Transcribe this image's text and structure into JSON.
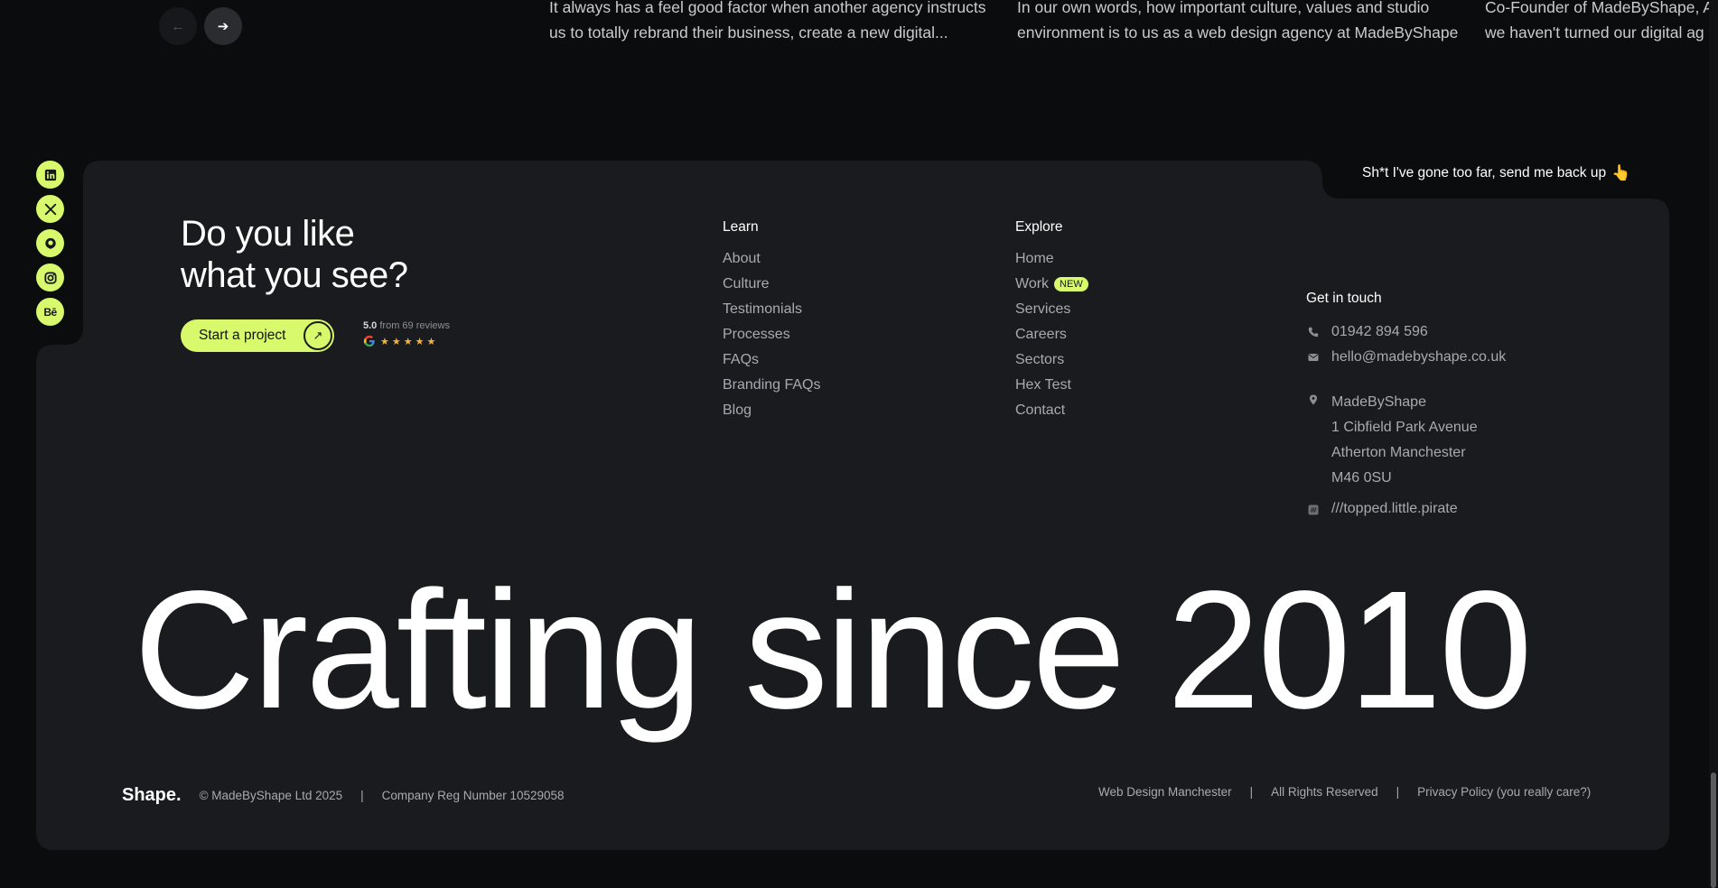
{
  "carousel": {
    "prev_icon": "arrow-left-icon",
    "next_icon": "arrow-right-icon",
    "quotes": [
      {
        "line1": "It always has a feel good factor when another agency instructs",
        "line2": "us to totally rebrand their business, create a new digital..."
      },
      {
        "line1": "In our own words, how important culture, values and studio",
        "line2": "environment is to us as a web design agency at MadeByShape"
      },
      {
        "line1": "Co-Founder of MadeByShape, A",
        "line2": "we haven't turned our digital ag"
      }
    ]
  },
  "social": [
    "linkedin-icon",
    "x-icon",
    "github-icon",
    "instagram-icon",
    "behance-icon"
  ],
  "behance_label": "Bē",
  "back_up": {
    "label": "Sh*t I've gone too far, send me back up",
    "emoji": "👆"
  },
  "headline": {
    "line1": "Do you like",
    "line2": "what you see?"
  },
  "cta": {
    "label": "Start a project",
    "arrow": "↗"
  },
  "rating": {
    "score": "5.0",
    "text": " from 69 reviews",
    "stars": "★★★★★",
    "star_count": 5
  },
  "learn": {
    "title": "Learn",
    "links": [
      "About",
      "Culture",
      "Testimonials",
      "Processes",
      "FAQs",
      "Branding FAQs",
      "Blog"
    ]
  },
  "explore": {
    "title": "Explore",
    "links": [
      "Home",
      "Work",
      "Services",
      "Careers",
      "Sectors",
      "Hex Test",
      "Contact"
    ],
    "work_badge": "NEW"
  },
  "contact": {
    "title": "Get in touch",
    "phone": "01942 894 596",
    "email": "hello@madebyshape.co.uk",
    "address": [
      "MadeByShape",
      "1 Cibfield Park Avenue",
      "Atherton Manchester",
      "M46 0SU"
    ],
    "what3words": "///topped.little.pirate"
  },
  "big_text": "Crafting since 2010",
  "bottom": {
    "logo": "Shape.",
    "copyright": "© MadeByShape Ltd 2025",
    "company_reg": "Company Reg Number 10529058",
    "sep": "|",
    "links": [
      "Web Design Manchester",
      "All Rights Reserved",
      "Privacy Policy (you really care?)"
    ]
  },
  "colors": {
    "accent": "#d7f96b",
    "card": "#1a1b1e",
    "page": "#0b0c0e"
  }
}
